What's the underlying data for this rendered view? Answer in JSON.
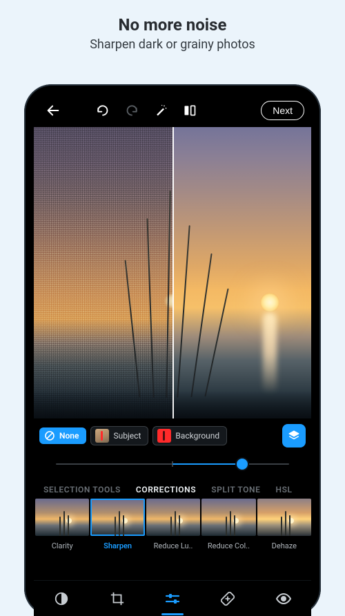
{
  "promo": {
    "title": "No more noise",
    "subtitle": "Sharpen dark or grainy photos"
  },
  "toolbar": {
    "next_label": "Next"
  },
  "selection": {
    "none_label": "None",
    "subject_label": "Subject",
    "background_label": "Background"
  },
  "slider": {
    "min": -100,
    "max": 100,
    "value": 60
  },
  "tabs": {
    "items": [
      "SELECTION TOOLS",
      "CORRECTIONS",
      "SPLIT TONE",
      "HSL"
    ],
    "active_index": 1
  },
  "presets": {
    "items": [
      {
        "label": "Clarity"
      },
      {
        "label": "Sharpen"
      },
      {
        "label": "Reduce Lu.."
      },
      {
        "label": "Reduce Col.."
      },
      {
        "label": "Dehaze"
      }
    ],
    "selected_index": 1
  },
  "bottom_nav": {
    "items": [
      "looks",
      "crop",
      "adjust",
      "heal",
      "redeye"
    ],
    "active_index": 2
  },
  "colors": {
    "accent": "#1a9cff"
  }
}
